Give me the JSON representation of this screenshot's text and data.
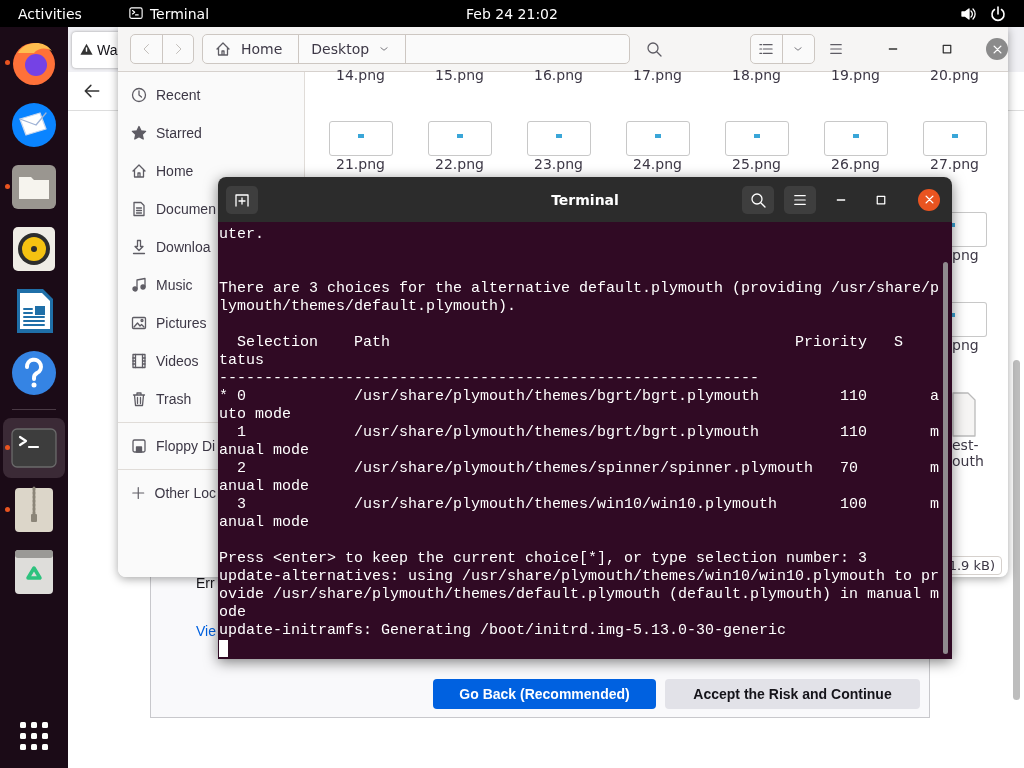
{
  "top_bar": {
    "activities": "Activities",
    "app": "Terminal",
    "clock": "Feb 24 21:02"
  },
  "dock": {
    "items": [
      {
        "kind": "firefox",
        "running": true,
        "selected": false
      },
      {
        "kind": "mail",
        "running": false,
        "selected": false
      },
      {
        "kind": "files",
        "running": true,
        "selected": false
      },
      {
        "kind": "music",
        "running": false,
        "selected": false
      },
      {
        "kind": "writer",
        "running": false,
        "selected": false
      },
      {
        "kind": "help",
        "running": false,
        "selected": false
      },
      {
        "kind": "terminal",
        "running": true,
        "selected": true
      },
      {
        "kind": "archive",
        "running": true,
        "selected": false
      },
      {
        "kind": "trash",
        "running": false,
        "selected": false
      }
    ]
  },
  "browser": {
    "tab_title": "Wa",
    "error_label": "Err",
    "link": "Vie",
    "buttons": [
      {
        "label": "Go Back (Recommended)",
        "kind": "primary"
      },
      {
        "label": "Accept the Risk and Continue",
        "kind": "secondary"
      }
    ]
  },
  "files": {
    "nav": [
      {
        "kind": "back",
        "disabled": true
      },
      {
        "kind": "forward",
        "disabled": true
      }
    ],
    "path": [
      {
        "label": "Home",
        "kind": "home"
      },
      {
        "label": "Desktop",
        "kind": "folder"
      }
    ],
    "sidebar": {
      "sections": [
        [
          {
            "label": "Recent",
            "kind": "recent"
          },
          {
            "label": "Starred",
            "kind": "starred"
          },
          {
            "label": "Home",
            "kind": "home"
          },
          {
            "label": "Documen",
            "kind": "documents"
          },
          {
            "label": "Downloa",
            "kind": "downloads"
          },
          {
            "label": "Music",
            "kind": "music"
          },
          {
            "label": "Pictures",
            "kind": "pictures"
          },
          {
            "label": "Videos",
            "kind": "videos"
          },
          {
            "label": "Trash",
            "kind": "trash"
          }
        ],
        [
          {
            "label": "Floppy Di",
            "kind": "floppy"
          }
        ],
        [
          {
            "label": "Other Loc",
            "kind": "other"
          }
        ]
      ]
    },
    "top_row": [
      "14.png",
      "15.png",
      "16.png",
      "17.png",
      "18.png",
      "19.png",
      "20.png"
    ],
    "grid": [
      "21.png",
      "22.png",
      "23.png",
      "24.png",
      "25.png",
      "26.png",
      "27.png"
    ],
    "edge_items": [
      {
        "kind": "image",
        "label": [
          "png"
        ]
      },
      {
        "kind": "image",
        "label": [
          "png"
        ]
      },
      {
        "kind": "file",
        "label": [
          "est-",
          "outh"
        ]
      }
    ],
    "status": "1.9 kB)"
  },
  "terminal": {
    "title": "Terminal",
    "blocks": [
      [
        "uter."
      ],
      [
        "There are 3 choices for the alternative default.plymouth (providing /usr/share/p",
        "lymouth/themes/default.plymouth)."
      ],
      [
        "  Selection    Path                                             Priority   S",
        "tatus",
        "------------------------------------------------------------",
        "* 0            /usr/share/plymouth/themes/bgrt/bgrt.plymouth         110       a",
        "uto mode",
        "  1            /usr/share/plymouth/themes/bgrt/bgrt.plymouth         110       m",
        "anual mode",
        "  2            /usr/share/plymouth/themes/spinner/spinner.plymouth   70        m",
        "anual mode",
        "  3            /usr/share/plymouth/themes/win10/win10.plymouth       100       m",
        "anual mode"
      ],
      [
        "Press <enter> to keep the current choice[*], or type selection number: 3",
        "update-alternatives: using /usr/share/plymouth/themes/win10/win10.plymouth to pr",
        "ovide /usr/share/plymouth/themes/default.plymouth (default.plymouth) in manual m",
        "ode",
        "update-initramfs: Generating /boot/initrd.img-5.13.0-30-generic"
      ]
    ]
  }
}
